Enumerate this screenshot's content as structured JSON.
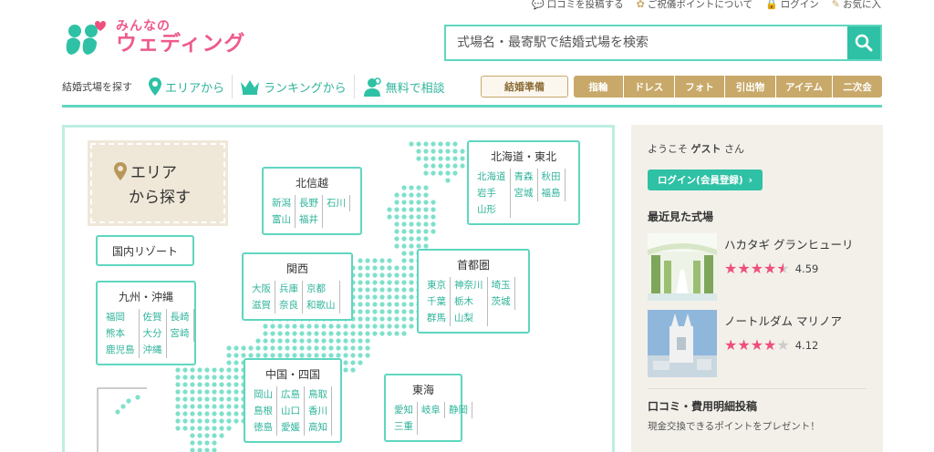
{
  "toplinks": [
    {
      "label": "口コミを投稿する",
      "icon": "speech-bubble-icon"
    },
    {
      "label": "ご祝儀ポイントについて",
      "icon": "gift-icon"
    },
    {
      "label": "ログイン",
      "icon": "lock-icon"
    },
    {
      "label": "お気に入",
      "icon": "pencil-icon"
    }
  ],
  "logo": {
    "sub": "みんなの",
    "main": "ウェディング"
  },
  "search": {
    "placeholder": "式場名・最寄駅で結婚式場を検索"
  },
  "nav": {
    "label": "結婚式場を探す",
    "items": [
      {
        "label": "エリアから",
        "icon": "pin-icon"
      },
      {
        "label": "ランキングから",
        "icon": "crown-icon"
      },
      {
        "label": "無料で相談",
        "icon": "advisor-icon"
      }
    ],
    "prep": "結婚準備",
    "cats": [
      "指輪",
      "ドレス",
      "フォト",
      "引出物",
      "アイテム",
      "二次会"
    ]
  },
  "map": {
    "title_l1": "エリア",
    "title_l2": "から探す",
    "resort": "国内リゾート",
    "regions": {
      "hokuriku": {
        "name": "北信越",
        "prefs": [
          "新潟",
          "長野",
          "石川",
          "富山",
          "福井"
        ]
      },
      "hokkaido": {
        "name": "北海道・東北",
        "prefs": [
          "北海道",
          "青森",
          "秋田",
          "岩手",
          "宮城",
          "福島",
          "山形"
        ]
      },
      "kanto": {
        "name": "首都圏",
        "prefs": [
          "東京",
          "神奈川",
          "埼玉",
          "千葉",
          "栃木",
          "茨城",
          "群馬",
          "山梨"
        ]
      },
      "kansai": {
        "name": "関西",
        "prefs": [
          "大阪",
          "兵庫",
          "京都",
          "滋賀",
          "奈良",
          "和歌山"
        ]
      },
      "kyushu": {
        "name": "九州・沖縄",
        "prefs": [
          "福岡",
          "佐賀",
          "長崎",
          "熊本",
          "大分",
          "宮崎",
          "鹿児島",
          "沖縄"
        ]
      },
      "chugoku": {
        "name": "中国・四国",
        "prefs": [
          "岡山",
          "広島",
          "鳥取",
          "島根",
          "山口",
          "香川",
          "徳島",
          "愛媛",
          "高知"
        ]
      },
      "tokai": {
        "name": "東海",
        "prefs": [
          "愛知",
          "岐阜",
          "静岡",
          "三重"
        ]
      }
    }
  },
  "sidebar": {
    "welcome_pre": "ようこそ ",
    "welcome_name": "ゲスト",
    "welcome_post": " さん",
    "login": "ログイン(会員登録)",
    "recent_title": "最近見た式場",
    "venues": [
      {
        "name": "ハカタギ グランヒューリ",
        "rating": "4.59",
        "stars": 4.5
      },
      {
        "name": "ノートルダム マリノア",
        "rating": "4.12",
        "stars": 4
      }
    ],
    "kuchi_title": "口コミ・費用明細投稿",
    "kuchi_sub": "現金交換できるポイントをプレゼント！"
  },
  "colors": {
    "accent": "#2fc1a5",
    "gold": "#c8a96a",
    "pink": "#ee4f7d"
  }
}
